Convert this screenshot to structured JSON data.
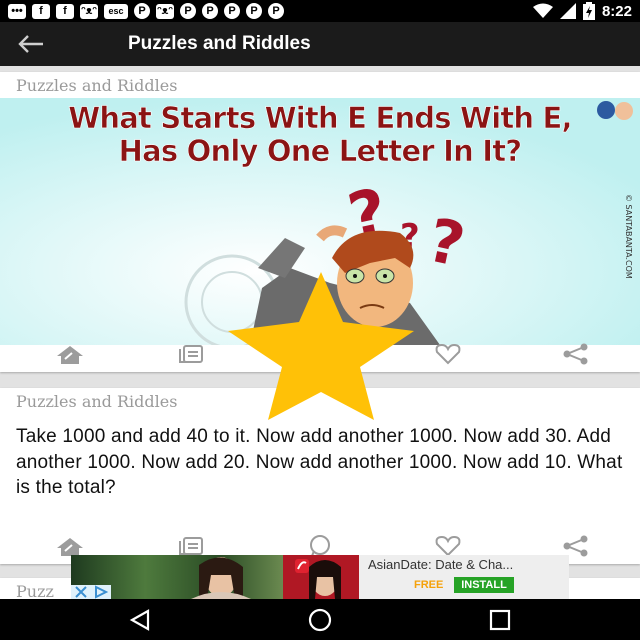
{
  "status_bar": {
    "time": "8:22",
    "notification_icons": [
      "message-icon",
      "facebook-icon",
      "facebook-icon",
      "cat-icon",
      "esc-icon",
      "pinterest-icon",
      "cat-icon",
      "pinterest-icon",
      "pinterest-icon",
      "pinterest-icon",
      "pinterest-icon",
      "pinterest-icon"
    ],
    "esc_label": "esc"
  },
  "app_bar": {
    "title": "Puzzles and Riddles",
    "back_icon": "arrow-left-icon"
  },
  "cards": [
    {
      "header": "Puzzles and Riddles",
      "image": {
        "headline_line1": "What Starts With E Ends With E,",
        "headline_line2": "Has Only One Letter In It?",
        "watermark": "© SANTABANTA.COM",
        "bg_color": "#d6f3f3",
        "headline_color": "#8b1414"
      },
      "actions": [
        "share-home-icon",
        "copy-icon",
        "whatsapp-icon",
        "heart-icon",
        "share-icon"
      ]
    },
    {
      "header": "Puzzles and Riddles",
      "text": "Take 1000 and add 40 to it. Now add another 1000. Now add 30. Add another 1000. Now add 20. Now add another 1000. Now add 10. What is the total?",
      "actions": [
        "share-home-icon",
        "copy-icon",
        "whatsapp-icon",
        "heart-icon",
        "share-icon"
      ]
    },
    {
      "header": "Puzz"
    }
  ],
  "ad": {
    "title": "AsianDate: Date & Cha...",
    "free_label": "FREE",
    "install_label": "INSTALL"
  },
  "overlay": {
    "icon": "star-icon",
    "color": "#ffc107"
  },
  "nav_bar": {
    "buttons": [
      "back-triangle-icon",
      "home-circle-icon",
      "recents-square-icon"
    ]
  }
}
